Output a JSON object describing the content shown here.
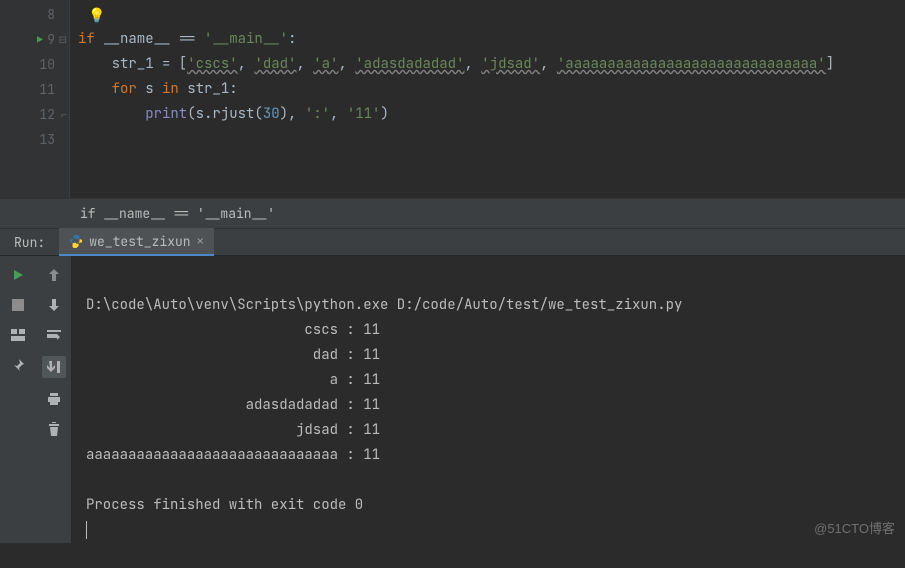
{
  "editor": {
    "bulb": "💡",
    "lines": {
      "8": "",
      "9": {
        "indent": "",
        "kw_if": "if",
        "var": " __name__ ",
        "eq": "== ",
        "str": "'__main__'",
        "colon": ":"
      },
      "10": {
        "indent": "    ",
        "lhs": "str_1 = [",
        "s1": "'cscs'",
        "c1": ", ",
        "s2": "'dad'",
        "c2": ", ",
        "s3": "'a'",
        "c3": ", ",
        "s4": "'adasdadadad'",
        "c4": ", ",
        "s5": "'jdsad'",
        "c5": ", ",
        "s6": "'aaaaaaaaaaaaaaaaaaaaaaaaaaaaaa'",
        "rb": "]"
      },
      "11": {
        "indent": "    ",
        "kw_for": "for",
        "sp1": " s ",
        "kw_in": "in",
        "sp2": " str_1:",
        "colon": ""
      },
      "12": {
        "indent": "        ",
        "fn": "print",
        "open": "(s.rjust(",
        "num": "30",
        "mid": "), ",
        "s1": "':'",
        "c1": ", ",
        "s2": "'11'",
        "close": ")"
      },
      "13": ""
    },
    "line_numbers": [
      "8",
      "9",
      "10",
      "11",
      "12",
      "13"
    ]
  },
  "breadcrumb": "if __name__ == '__main__'",
  "run": {
    "label": "Run:",
    "tab_name": "we_test_zixun",
    "output": {
      "cmd": "D:\\code\\Auto\\venv\\Scripts\\python.exe D:/code/Auto/test/we_test_zixun.py",
      "rows": [
        "                          cscs : 11",
        "                           dad : 11",
        "                             a : 11",
        "                   adasdadadad : 11",
        "                         jdsad : 11",
        "aaaaaaaaaaaaaaaaaaaaaaaaaaaaaa : 11"
      ],
      "exit": "Process finished with exit code 0"
    }
  },
  "watermark": "@51CTO博客"
}
